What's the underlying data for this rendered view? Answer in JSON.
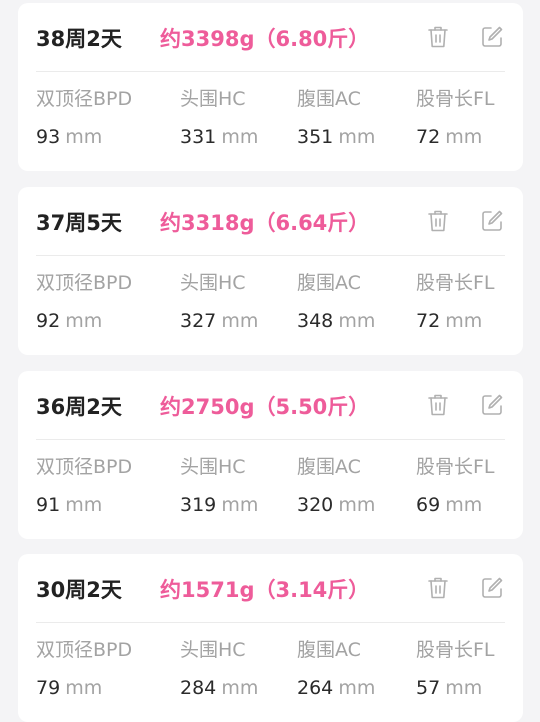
{
  "colors": {
    "background": "#f4f4f6",
    "card": "#ffffff",
    "accent_pink": "#ee5c9a",
    "label_gray": "#a3a3a3",
    "value_dark": "#2b2b2b"
  },
  "icons": {
    "delete": "trash-icon",
    "edit": "edit-icon"
  },
  "records": [
    {
      "week": "38周2天",
      "weight": "约3398g（6.80斤）",
      "metrics": [
        {
          "label": "双顶径BPD",
          "value": "93",
          "unit": "mm"
        },
        {
          "label": "头围HC",
          "value": "331",
          "unit": "mm"
        },
        {
          "label": "腹围AC",
          "value": "351",
          "unit": "mm"
        },
        {
          "label": "股骨长FL",
          "value": "72",
          "unit": "mm"
        }
      ]
    },
    {
      "week": "37周5天",
      "weight": "约3318g（6.64斤）",
      "metrics": [
        {
          "label": "双顶径BPD",
          "value": "92",
          "unit": "mm"
        },
        {
          "label": "头围HC",
          "value": "327",
          "unit": "mm"
        },
        {
          "label": "腹围AC",
          "value": "348",
          "unit": "mm"
        },
        {
          "label": "股骨长FL",
          "value": "72",
          "unit": "mm"
        }
      ]
    },
    {
      "week": "36周2天",
      "weight": "约2750g（5.50斤）",
      "metrics": [
        {
          "label": "双顶径BPD",
          "value": "91",
          "unit": "mm"
        },
        {
          "label": "头围HC",
          "value": "319",
          "unit": "mm"
        },
        {
          "label": "腹围AC",
          "value": "320",
          "unit": "mm"
        },
        {
          "label": "股骨长FL",
          "value": "69",
          "unit": "mm"
        }
      ]
    },
    {
      "week": "30周2天",
      "weight": "约1571g（3.14斤）",
      "metrics": [
        {
          "label": "双顶径BPD",
          "value": "79",
          "unit": "mm"
        },
        {
          "label": "头围HC",
          "value": "284",
          "unit": "mm"
        },
        {
          "label": "腹围AC",
          "value": "264",
          "unit": "mm"
        },
        {
          "label": "股骨长FL",
          "value": "57",
          "unit": "mm"
        }
      ]
    }
  ]
}
